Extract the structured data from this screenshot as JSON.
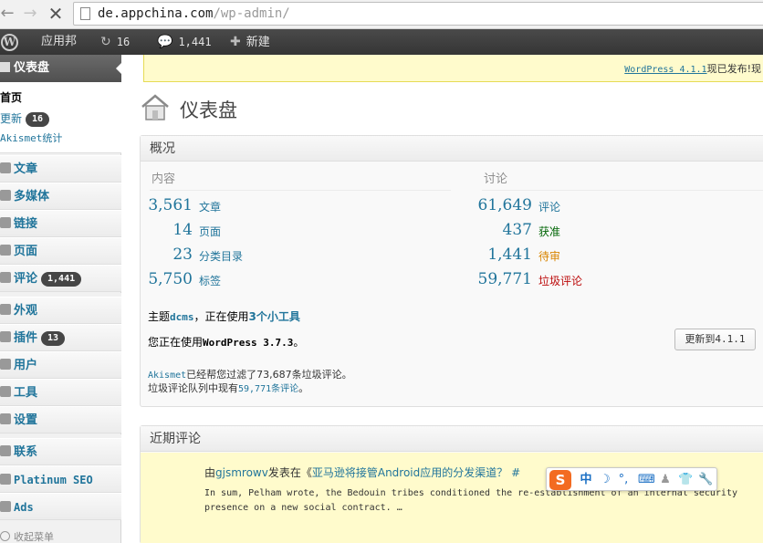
{
  "browser": {
    "url_host": "de.appchina.com",
    "url_path": "/wp-admin/"
  },
  "admin_bar": {
    "site_name": "应用邦",
    "updates_count": "16",
    "comments_count": "1,441",
    "new_label": "新建"
  },
  "sidebar": {
    "dashboard_label": "仪表盘",
    "submenu": {
      "home": "首页",
      "updates": "更新",
      "updates_badge": "16",
      "akismet": "Akismet统计"
    },
    "items": [
      {
        "label": "文章"
      },
      {
        "label": "多媒体"
      },
      {
        "label": "链接"
      },
      {
        "label": "页面"
      },
      {
        "label": "评论",
        "badge": "1,441"
      },
      {
        "label": "外观"
      },
      {
        "label": "插件",
        "badge": "13"
      },
      {
        "label": "用户"
      },
      {
        "label": "工具"
      },
      {
        "label": "设置"
      },
      {
        "label": "联系"
      },
      {
        "label": "Platinum SEO"
      },
      {
        "label": "Ads"
      }
    ],
    "collapse_label": "收起菜单"
  },
  "notice": {
    "link": "WordPress 4.1.1",
    "text": "现已发布!现"
  },
  "page": {
    "title": "仪表盘"
  },
  "overview": {
    "title": "概况",
    "content_heading": "内容",
    "discussion_heading": "讨论",
    "content_rows": [
      {
        "num": "3,561",
        "label": "文章"
      },
      {
        "num": "14",
        "label": "页面"
      },
      {
        "num": "23",
        "label": "分类目录"
      },
      {
        "num": "5,750",
        "label": "标签"
      }
    ],
    "discussion_rows": [
      {
        "num": "61,649",
        "label": "评论"
      },
      {
        "num": "437",
        "label": "获准"
      },
      {
        "num": "1,441",
        "label": "待审"
      },
      {
        "num": "59,771",
        "label": "垃圾评论"
      }
    ],
    "theme_prefix": "主题",
    "theme_name": "dcms",
    "theme_mid": "，正在使用",
    "widgets_link": "3个小工具",
    "version_prefix": "您正在使用",
    "version_name": "WordPress 3.7.3",
    "version_suffix": "。",
    "update_button": "更新到4.1.1",
    "akismet_link": "Akismet",
    "akismet_text": "已经帮您过滤了73,687条垃圾评论。",
    "spam_queue_prefix": "垃圾评论队列中现有",
    "spam_queue_link": "59,771条评论",
    "spam_queue_suffix": "。"
  },
  "recent_comments": {
    "title": "近期评论",
    "author": "gjsmrowv",
    "meta_prefix": "由",
    "meta_mid": "发表在《",
    "post_link": "亚马逊将接管Android应用的分发渠道？ #",
    "body": "In sum, Pelham wrote, the Bedouin tribes conditioned the re-establishment of an internal security presence on a new social contract. …"
  },
  "ime": {
    "logo": "S",
    "mode": "中"
  }
}
